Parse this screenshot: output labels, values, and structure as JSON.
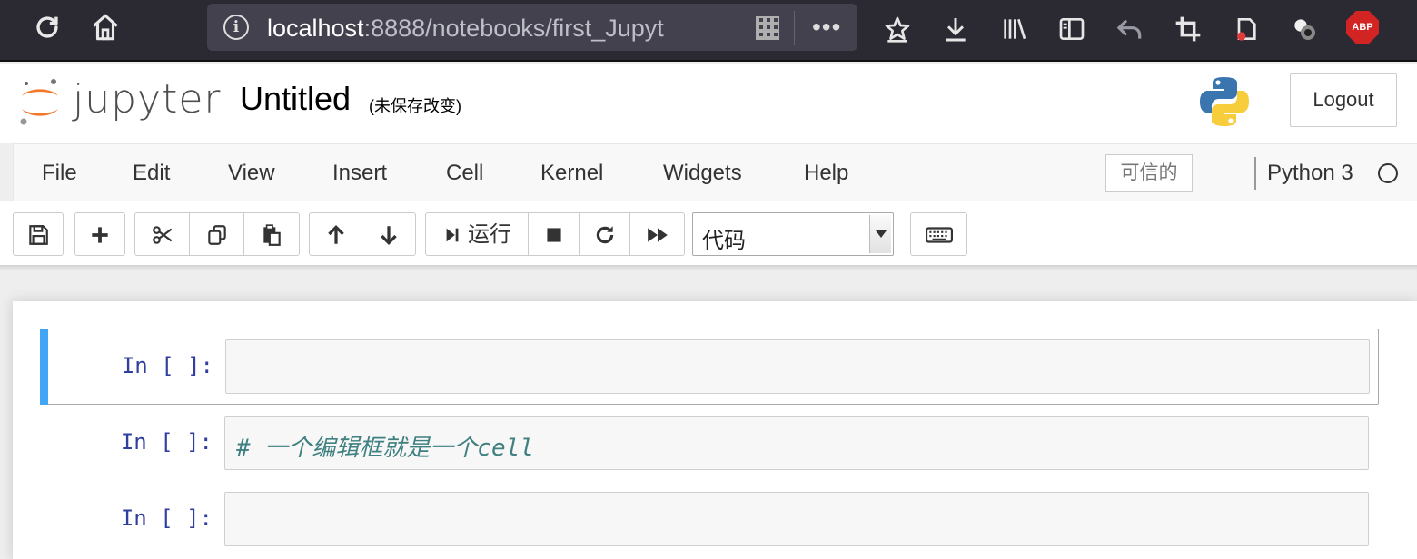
{
  "browser": {
    "url_host": "localhost",
    "url_rest": ":8888/notebooks/first_Jupyt",
    "more_label": "•••"
  },
  "header": {
    "logo_text": "jupyter",
    "notebook_title": "Untitled",
    "save_status": "(未保存改变)",
    "logout_label": "Logout"
  },
  "menubar": {
    "items": [
      "File",
      "Edit",
      "View",
      "Insert",
      "Cell",
      "Kernel",
      "Widgets",
      "Help"
    ],
    "trusted_label": "可信的",
    "kernel_name": "Python 3"
  },
  "toolbar": {
    "run_label": "运行",
    "cell_type": "代码"
  },
  "cells": [
    {
      "prompt": "In [ ]:",
      "source": "",
      "selected": true
    },
    {
      "prompt": "In [ ]:",
      "source": "# 一个编辑框就是一个cell",
      "selected": false
    },
    {
      "prompt": "In [ ]:",
      "source": "",
      "selected": false
    }
  ],
  "colors": {
    "selected_cell_accent": "#42a5f5",
    "prompt_color": "#303f9f",
    "comment_color": "#408080",
    "logo_orange": "#f37726"
  }
}
